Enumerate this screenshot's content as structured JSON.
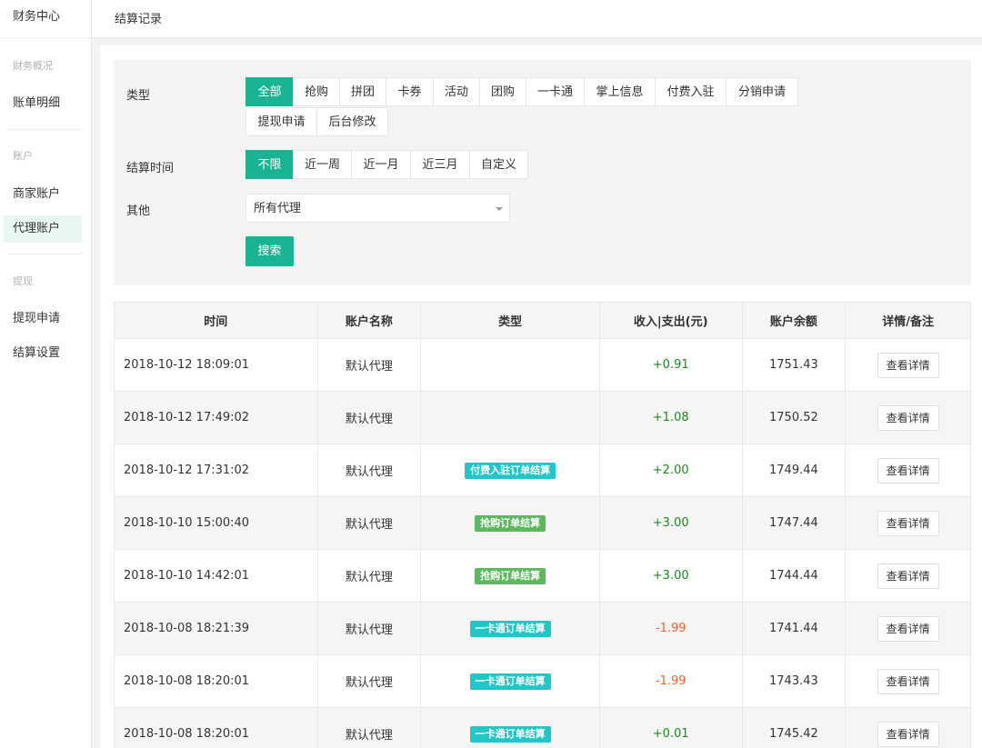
{
  "sidebar": {
    "title": "财务中心",
    "groups": [
      {
        "label": "财务概况",
        "items": [
          {
            "label": "账单明细",
            "active": false
          }
        ]
      },
      {
        "label": "账户",
        "items": [
          {
            "label": "商家账户",
            "active": false
          },
          {
            "label": "代理账户",
            "active": true
          }
        ]
      },
      {
        "label": "提现",
        "items": [
          {
            "label": "提现申请",
            "active": false
          },
          {
            "label": "结算设置",
            "active": false
          }
        ]
      }
    ]
  },
  "header": {
    "title": "结算记录"
  },
  "filter": {
    "type_label": "类型",
    "type_options": [
      "全部",
      "抢购",
      "拼团",
      "卡券",
      "活动",
      "团购",
      "一卡通",
      "掌上信息",
      "付费入驻",
      "分销申请",
      "提现申请",
      "后台修改"
    ],
    "type_selected": "全部",
    "time_label": "结算时间",
    "time_options": [
      "不限",
      "近一周",
      "近一月",
      "近三月",
      "自定义"
    ],
    "time_selected": "不限",
    "other_label": "其他",
    "agent_select_value": "所有代理",
    "search_label": "搜索"
  },
  "table": {
    "headers": [
      "时间",
      "账户名称",
      "类型",
      "收入|支出(元)",
      "账户余额",
      "详情/备注"
    ],
    "detail_label": "查看详情",
    "rows": [
      {
        "time": "2018-10-12 18:09:01",
        "name": "默认代理",
        "type": "",
        "type_color": "",
        "amount": "+0.91",
        "balance": "1751.43"
      },
      {
        "time": "2018-10-12 17:49:02",
        "name": "默认代理",
        "type": "",
        "type_color": "",
        "amount": "+1.08",
        "balance": "1750.52"
      },
      {
        "time": "2018-10-12 17:31:02",
        "name": "默认代理",
        "type": "付费入驻订单结算",
        "type_color": "#23c6c8",
        "amount": "+2.00",
        "balance": "1749.44"
      },
      {
        "time": "2018-10-10 15:00:40",
        "name": "默认代理",
        "type": "抢购订单结算",
        "type_color": "#5cb85c",
        "amount": "+3.00",
        "balance": "1747.44"
      },
      {
        "time": "2018-10-10 14:42:01",
        "name": "默认代理",
        "type": "抢购订单结算",
        "type_color": "#5cb85c",
        "amount": "+3.00",
        "balance": "1744.44"
      },
      {
        "time": "2018-10-08 18:21:39",
        "name": "默认代理",
        "type": "一卡通订单结算",
        "type_color": "#23c6c8",
        "amount": "-1.99",
        "balance": "1741.44"
      },
      {
        "time": "2018-10-08 18:20:01",
        "name": "默认代理",
        "type": "一卡通订单结算",
        "type_color": "#23c6c8",
        "amount": "-1.99",
        "balance": "1743.43"
      },
      {
        "time": "2018-10-08 18:20:01",
        "name": "默认代理",
        "type": "一卡通订单结算",
        "type_color": "#23c6c8",
        "amount": "+0.01",
        "balance": "1745.42"
      }
    ]
  },
  "colors": {
    "accent": "#1ab394",
    "positive": "#1b8a1b",
    "negative": "#e8642c"
  }
}
